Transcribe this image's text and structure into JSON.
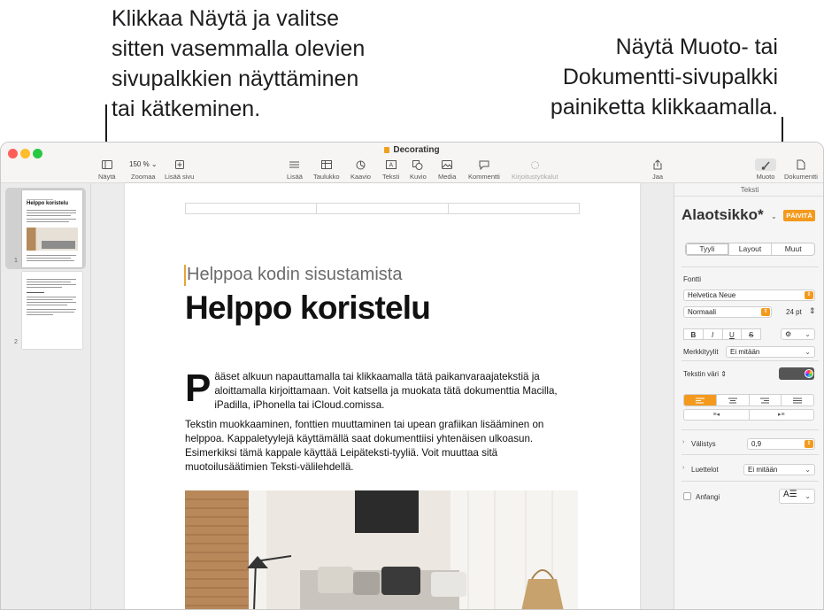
{
  "callouts": {
    "left": [
      "Klikkaa Näytä ja valitse",
      "sitten vasemmalla olevien",
      "sivupalkkien näyttäminen",
      "tai kätkeminen."
    ],
    "right": [
      "Näytä Muoto- tai",
      "Dokumentti-sivupalkki",
      "painiketta klikkaamalla."
    ]
  },
  "window": {
    "title": "Decorating"
  },
  "toolbar": {
    "view": "Näytä",
    "zoom_value": "150 %",
    "zoom": "Zoomaa",
    "add_page": "Lisää sivu",
    "insert": "Lisää",
    "table": "Taulukko",
    "chart": "Kaavio",
    "text": "Teksti",
    "shape": "Kuvio",
    "media": "Media",
    "comment": "Kommentti",
    "writing_tools": "Kirjoitustyökalut",
    "share": "Jaa",
    "format": "Muoto",
    "document": "Dokumentti"
  },
  "thumbnails": [
    {
      "number": "1",
      "title": "Helppo koristelu"
    },
    {
      "number": "2"
    }
  ],
  "document": {
    "subtitle": "Helppoa kodin sisustamista",
    "title": "Helppo koristelu",
    "dropcap": "P",
    "paragraph1": "ääset alkuun napauttamalla tai klikkaamalla tätä paikanvaraajatekstiä ja aloittamalla kirjoittamaan. Voit katsella ja muokata tätä dokumenttia Macilla, iPadilla, iPhonella tai iCloud.comissa.",
    "paragraph2": "Tekstin muokkaaminen, fonttien muuttaminen tai upean grafiikan lisääminen on helppoa. Kappaletyylejä käyttämällä saat dokumenttiisi yhtenäisen ulkoasun. Esimerkiksi tämä kappale käyttää Leipäteksti-tyyliä. Voit muuttaa sitä muotoilusäätimien Teksti-välilehdellä."
  },
  "inspector": {
    "header": "Teksti",
    "style_name": "Alaotsikko*",
    "update_button": "PÄIVITÄ",
    "tabs": [
      "Tyyli",
      "Layout",
      "Muut"
    ],
    "font_label": "Fontti",
    "font_family": "Helvetica Neue",
    "font_style": "Normaali",
    "font_size": "24 pt",
    "bold": "B",
    "italic": "I",
    "underline": "U",
    "strike": "S",
    "character_styles_label": "Merkkityylit",
    "character_styles_value": "Ei mitään",
    "text_color_label": "Tekstin väri",
    "text_color": "#555555",
    "spacing_label": "Välistys",
    "spacing_value": "0,9",
    "bullets_label": "Luettelot",
    "bullets_value": "Ei mitään",
    "dropcap_label": "Anfangi",
    "accent_color": "#f39a1e"
  }
}
